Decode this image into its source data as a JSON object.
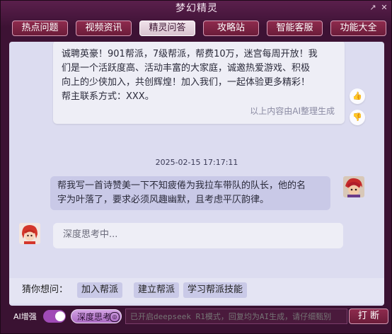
{
  "window": {
    "title": "梦幻精灵",
    "restore_glyph": "↗",
    "close_glyph": "✕"
  },
  "nav": {
    "tabs": [
      "热点问题",
      "视频资讯",
      "精灵问答",
      "攻略站",
      "智能客服",
      "功能大全"
    ],
    "active": "精灵问答"
  },
  "chat": {
    "ai_message": {
      "lines": [
        "诚聘英豪！901帮派，7级帮派，帮费10万，迷宫每周开放！我",
        "们是一个活跃度高、活动丰富的大家庭，诚邀热爱游戏、积极",
        "向上的少侠加入，共创辉煌！加入我们，一起体验更多精彩！",
        "帮主联系方式：XXX。"
      ],
      "note": "以上内容由AI整理生成"
    },
    "like_glyph": "👍",
    "dislike_glyph": "👎",
    "timestamp": "2025-02-15 17:17:11",
    "user_message": {
      "lines": [
        "帮我写一首诗赞美一下不知疲倦为我拉车带队的队长，他的名",
        "字为叶落了，要求必须风趣幽默，且考虑平仄韵律。"
      ]
    },
    "thinking": "深度思考中..."
  },
  "suggest": {
    "label": "猜你想问：",
    "chips": [
      "加入帮派",
      "建立帮派",
      "学习帮派技能"
    ]
  },
  "bottom": {
    "ai_label": "AI增强",
    "deep_button": "深度思考",
    "deep_icon": "◎",
    "input_placeholder": "已开启deepseek R1模式，回复均为AI生成，请仔细甄别",
    "interrupt_button": "打 断"
  },
  "colors": {
    "frame": "#3d1234",
    "accent": "#8e2b4e",
    "panel": "#dcdcf0"
  }
}
